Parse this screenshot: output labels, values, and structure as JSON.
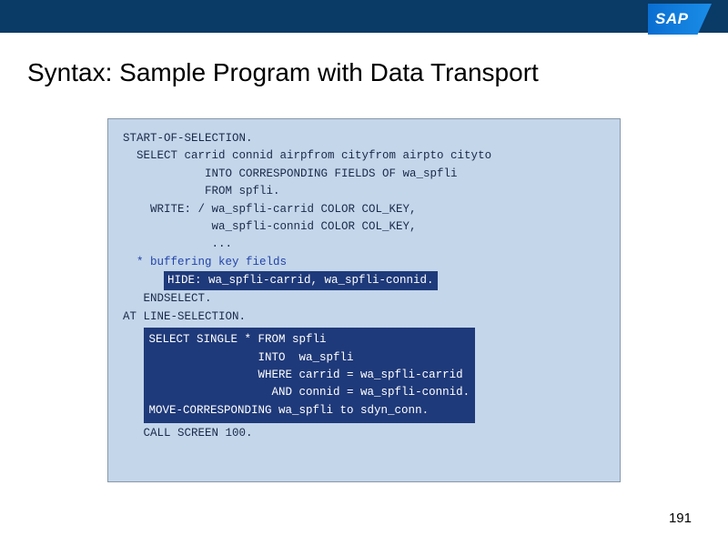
{
  "header": {
    "logo_text": "SAP"
  },
  "title": "Syntax: Sample Program with Data Transport",
  "code": {
    "l01": "START-OF-SELECTION.",
    "l02": "",
    "l03": "  SELECT carrid connid airpfrom cityfrom airpto cityto",
    "l04": "            INTO CORRESPONDING FIELDS OF wa_spfli",
    "l05": "            FROM spfli.",
    "l06": "    WRITE: / wa_spfli-carrid COLOR COL_KEY,",
    "l07": "             wa_spfli-connid COLOR COL_KEY,",
    "l08": "             ...",
    "l09": "",
    "comment": "  * buffering key fields",
    "hide_indent": "      ",
    "hide": "HIDE: wa_spfli-carrid, wa_spfli-connid.",
    "l10": "",
    "l11": "   ENDSELECT.",
    "l12": "",
    "l13": "AT LINE-SELECTION.",
    "l14": "",
    "block_indent": "   ",
    "b1": "SELECT SINGLE * FROM spfli",
    "b2": "                INTO  wa_spfli",
    "b3": "                WHERE carrid = wa_spfli-carrid",
    "b4": "                  AND connid = wa_spfli-connid.",
    "b5": "MOVE-CORRESPONDING wa_spfli to sdyn_conn.",
    "l15": "   CALL SCREEN 100."
  },
  "page_number": "191"
}
